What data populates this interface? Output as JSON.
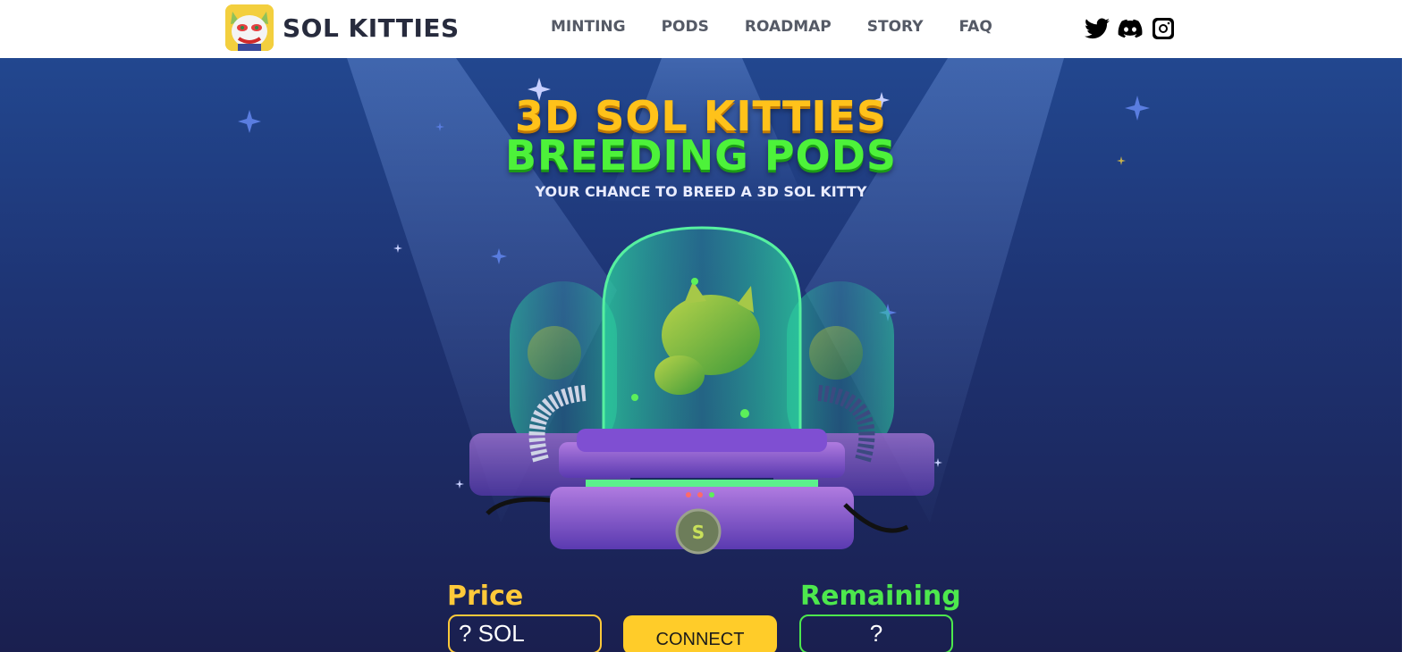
{
  "brand": {
    "name": "SOL KITTIES"
  },
  "nav": [
    {
      "label": "MINTING"
    },
    {
      "label": "PODS"
    },
    {
      "label": "ROADMAP"
    },
    {
      "label": "STORY"
    },
    {
      "label": "FAQ"
    }
  ],
  "socials": [
    "twitter-icon",
    "discord-icon",
    "instagram-icon"
  ],
  "hero": {
    "title_line1": "3D SOL KITTIES",
    "title_line2": "BREEDING PODS",
    "subtitle": "YOUR CHANCE TO BREED A 3D SOL KITTY"
  },
  "mint": {
    "price_label": "Price",
    "price_value": "? SOL",
    "connect_label": "CONNECT",
    "remaining_label": "Remaining",
    "remaining_value": "?"
  },
  "colors": {
    "price": "#ffc93a",
    "remaining": "#4de84d",
    "connect_button": "#ffcc29",
    "title_yellow": "#ffc21a",
    "title_green": "#4df23a"
  }
}
